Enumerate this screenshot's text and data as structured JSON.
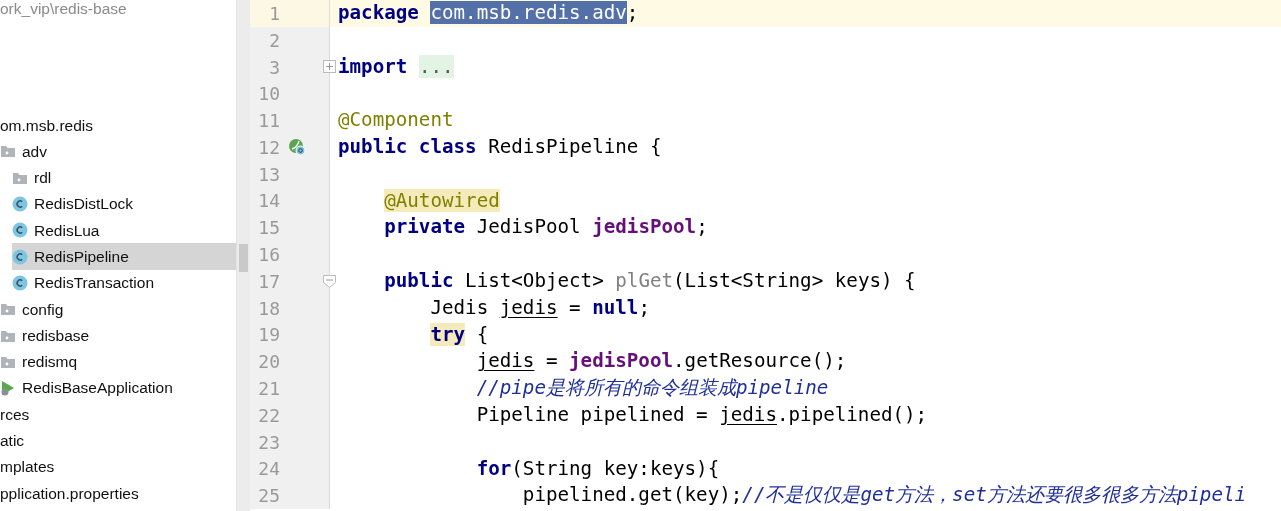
{
  "project_path": "ork_vip\\redis-base",
  "tree": [
    {
      "label": "om.msb.redis",
      "selected": false,
      "children": [
        {
          "label": "adv",
          "kind": "folder",
          "selected": false,
          "children": [
            {
              "label": "rdl",
              "kind": "folder",
              "selected": false
            },
            {
              "label": "RedisDistLock",
              "kind": "class",
              "selected": false
            },
            {
              "label": "RedisLua",
              "kind": "class",
              "selected": false
            },
            {
              "label": "RedisPipeline",
              "kind": "class",
              "selected": true
            },
            {
              "label": "RedisTransaction",
              "kind": "class",
              "selected": false
            }
          ]
        },
        {
          "label": "config",
          "kind": "folder",
          "selected": false
        },
        {
          "label": "redisbase",
          "kind": "folder",
          "selected": false
        },
        {
          "label": "redismq",
          "kind": "folder",
          "selected": false
        },
        {
          "label": "RedisBaseApplication",
          "kind": "app",
          "selected": false
        }
      ]
    },
    {
      "label": "rces",
      "selected": false
    },
    {
      "label": "atic",
      "selected": false
    },
    {
      "label": "mplates",
      "selected": false
    },
    {
      "label": "pplication.properties",
      "selected": false
    }
  ],
  "code_lines": [
    {
      "number": "1",
      "current": true,
      "tokens": [
        {
          "text": "package",
          "kind": "keyword"
        },
        {
          "text": " com.msb.redis.adv",
          "kind": "selection"
        },
        {
          "text": ";",
          "kind": "plain"
        }
      ]
    },
    {
      "number": "2",
      "current": false
    },
    {
      "number": "3",
      "current": false,
      "expanded": false,
      "tokens": [
        {
          "text": "import",
          "kind": "keyword"
        },
        {
          "text": " ...",
          "kind": "folded"
        }
      ]
    },
    {
      "number": "10",
      "current": false
    },
    {
      "number": "11",
      "current": false,
      "tokens": [
        {
          "text": "@Component",
          "kind": "annotation"
        }
      ]
    },
    {
      "number": "12",
      "current": false,
      "kind": "bean-class",
      "tokens": [
        {
          "text": "public class",
          "kind": "keyword"
        },
        {
          "text": " RedisPipeline {",
          "kind": "plain"
        }
      ]
    },
    {
      "number": "13",
      "current": false
    },
    {
      "number": "14",
      "current": false,
      "tokens": [
        {
          "text": "    @Autowired",
          "kind": "annotation-highlight"
        }
      ]
    },
    {
      "number": "15",
      "current": false,
      "kind": "autowired-field",
      "tokens": [
        {
          "text": "    private",
          "kind": "keyword"
        },
        {
          "text": " JedisPool ",
          "kind": "plain"
        },
        {
          "text": "jedisPool",
          "kind": "field"
        },
        {
          "text": ";",
          "kind": "plain"
        }
      ]
    },
    {
      "number": "16",
      "current": false
    },
    {
      "number": "17",
      "current": false,
      "expanded": true,
      "tokens": [
        {
          "text": "    public",
          "kind": "keyword"
        },
        {
          "text": " List<Object> ",
          "kind": "plain"
        },
        {
          "text": "plGet",
          "kind": "unused"
        },
        {
          "text": "(List<String> keys) {",
          "kind": "plain"
        }
      ]
    },
    {
      "number": "18",
      "current": false,
      "tokens": [
        {
          "text": "        Jedis ",
          "kind": "plain"
        },
        {
          "text": "jedis",
          "kind": "reassigned"
        },
        {
          "text": " = ",
          "kind": "plain"
        },
        {
          "text": "null",
          "kind": "keyword"
        },
        {
          "text": ";",
          "kind": "plain"
        }
      ]
    },
    {
      "number": "19",
      "current": false,
      "tokens": [
        {
          "text": "        try",
          "kind": "keyword-highlight"
        },
        {
          "text": " {",
          "kind": "plain"
        }
      ]
    },
    {
      "number": "20",
      "current": false,
      "tokens": [
        {
          "text": "            jedis",
          "kind": "reassigned"
        },
        {
          "text": " = ",
          "kind": "plain"
        },
        {
          "text": "jedisPool",
          "kind": "field"
        },
        {
          "text": ".getResource();",
          "kind": "plain"
        }
      ]
    },
    {
      "number": "21",
      "current": false,
      "tokens": [
        {
          "text": "            //pipe是将所有的命令组装成pipeline",
          "kind": "comment"
        }
      ]
    },
    {
      "number": "22",
      "current": false,
      "tokens": [
        {
          "text": "            Pipeline pipelined = ",
          "kind": "plain"
        },
        {
          "text": "jedis",
          "kind": "reassigned"
        },
        {
          "text": ".pipelined();",
          "kind": "plain"
        }
      ]
    },
    {
      "number": "23",
      "current": false
    },
    {
      "number": "24",
      "current": false,
      "tokens": [
        {
          "text": "            for",
          "kind": "keyword"
        },
        {
          "text": "(String key:keys){",
          "kind": "plain"
        }
      ]
    },
    {
      "number": "25",
      "current": false,
      "tokens": [
        {
          "text": "                pipelined.get(key);",
          "kind": "plain"
        },
        {
          "text": "//不是仅仅是get方法，set方法还要很多很多方法pipeli",
          "kind": "comment"
        }
      ]
    }
  ]
}
